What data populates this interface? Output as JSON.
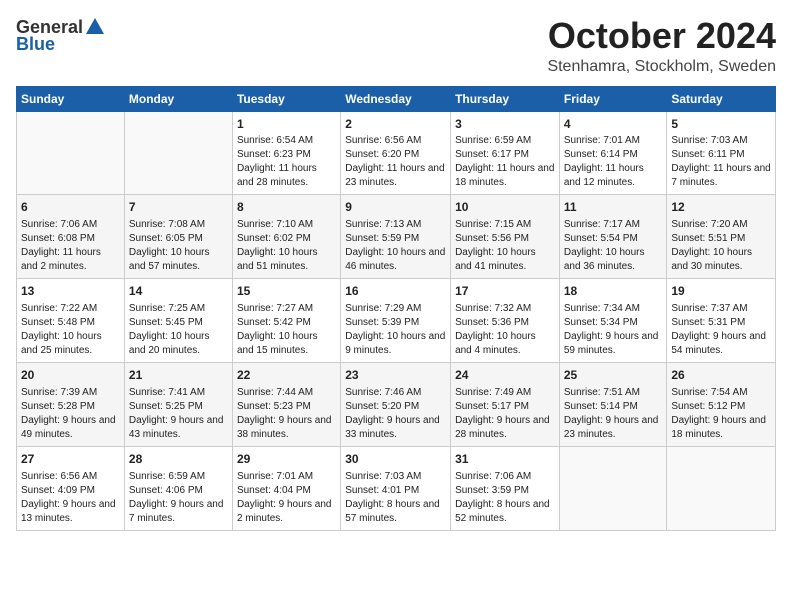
{
  "header": {
    "logo_general": "General",
    "logo_blue": "Blue",
    "month": "October 2024",
    "location": "Stenhamra, Stockholm, Sweden"
  },
  "weekdays": [
    "Sunday",
    "Monday",
    "Tuesday",
    "Wednesday",
    "Thursday",
    "Friday",
    "Saturday"
  ],
  "weeks": [
    [
      {
        "day": "",
        "sunrise": "",
        "sunset": "",
        "daylight": ""
      },
      {
        "day": "",
        "sunrise": "",
        "sunset": "",
        "daylight": ""
      },
      {
        "day": "1",
        "sunrise": "Sunrise: 6:54 AM",
        "sunset": "Sunset: 6:23 PM",
        "daylight": "Daylight: 11 hours and 28 minutes."
      },
      {
        "day": "2",
        "sunrise": "Sunrise: 6:56 AM",
        "sunset": "Sunset: 6:20 PM",
        "daylight": "Daylight: 11 hours and 23 minutes."
      },
      {
        "day": "3",
        "sunrise": "Sunrise: 6:59 AM",
        "sunset": "Sunset: 6:17 PM",
        "daylight": "Daylight: 11 hours and 18 minutes."
      },
      {
        "day": "4",
        "sunrise": "Sunrise: 7:01 AM",
        "sunset": "Sunset: 6:14 PM",
        "daylight": "Daylight: 11 hours and 12 minutes."
      },
      {
        "day": "5",
        "sunrise": "Sunrise: 7:03 AM",
        "sunset": "Sunset: 6:11 PM",
        "daylight": "Daylight: 11 hours and 7 minutes."
      }
    ],
    [
      {
        "day": "6",
        "sunrise": "Sunrise: 7:06 AM",
        "sunset": "Sunset: 6:08 PM",
        "daylight": "Daylight: 11 hours and 2 minutes."
      },
      {
        "day": "7",
        "sunrise": "Sunrise: 7:08 AM",
        "sunset": "Sunset: 6:05 PM",
        "daylight": "Daylight: 10 hours and 57 minutes."
      },
      {
        "day": "8",
        "sunrise": "Sunrise: 7:10 AM",
        "sunset": "Sunset: 6:02 PM",
        "daylight": "Daylight: 10 hours and 51 minutes."
      },
      {
        "day": "9",
        "sunrise": "Sunrise: 7:13 AM",
        "sunset": "Sunset: 5:59 PM",
        "daylight": "Daylight: 10 hours and 46 minutes."
      },
      {
        "day": "10",
        "sunrise": "Sunrise: 7:15 AM",
        "sunset": "Sunset: 5:56 PM",
        "daylight": "Daylight: 10 hours and 41 minutes."
      },
      {
        "day": "11",
        "sunrise": "Sunrise: 7:17 AM",
        "sunset": "Sunset: 5:54 PM",
        "daylight": "Daylight: 10 hours and 36 minutes."
      },
      {
        "day": "12",
        "sunrise": "Sunrise: 7:20 AM",
        "sunset": "Sunset: 5:51 PM",
        "daylight": "Daylight: 10 hours and 30 minutes."
      }
    ],
    [
      {
        "day": "13",
        "sunrise": "Sunrise: 7:22 AM",
        "sunset": "Sunset: 5:48 PM",
        "daylight": "Daylight: 10 hours and 25 minutes."
      },
      {
        "day": "14",
        "sunrise": "Sunrise: 7:25 AM",
        "sunset": "Sunset: 5:45 PM",
        "daylight": "Daylight: 10 hours and 20 minutes."
      },
      {
        "day": "15",
        "sunrise": "Sunrise: 7:27 AM",
        "sunset": "Sunset: 5:42 PM",
        "daylight": "Daylight: 10 hours and 15 minutes."
      },
      {
        "day": "16",
        "sunrise": "Sunrise: 7:29 AM",
        "sunset": "Sunset: 5:39 PM",
        "daylight": "Daylight: 10 hours and 9 minutes."
      },
      {
        "day": "17",
        "sunrise": "Sunrise: 7:32 AM",
        "sunset": "Sunset: 5:36 PM",
        "daylight": "Daylight: 10 hours and 4 minutes."
      },
      {
        "day": "18",
        "sunrise": "Sunrise: 7:34 AM",
        "sunset": "Sunset: 5:34 PM",
        "daylight": "Daylight: 9 hours and 59 minutes."
      },
      {
        "day": "19",
        "sunrise": "Sunrise: 7:37 AM",
        "sunset": "Sunset: 5:31 PM",
        "daylight": "Daylight: 9 hours and 54 minutes."
      }
    ],
    [
      {
        "day": "20",
        "sunrise": "Sunrise: 7:39 AM",
        "sunset": "Sunset: 5:28 PM",
        "daylight": "Daylight: 9 hours and 49 minutes."
      },
      {
        "day": "21",
        "sunrise": "Sunrise: 7:41 AM",
        "sunset": "Sunset: 5:25 PM",
        "daylight": "Daylight: 9 hours and 43 minutes."
      },
      {
        "day": "22",
        "sunrise": "Sunrise: 7:44 AM",
        "sunset": "Sunset: 5:23 PM",
        "daylight": "Daylight: 9 hours and 38 minutes."
      },
      {
        "day": "23",
        "sunrise": "Sunrise: 7:46 AM",
        "sunset": "Sunset: 5:20 PM",
        "daylight": "Daylight: 9 hours and 33 minutes."
      },
      {
        "day": "24",
        "sunrise": "Sunrise: 7:49 AM",
        "sunset": "Sunset: 5:17 PM",
        "daylight": "Daylight: 9 hours and 28 minutes."
      },
      {
        "day": "25",
        "sunrise": "Sunrise: 7:51 AM",
        "sunset": "Sunset: 5:14 PM",
        "daylight": "Daylight: 9 hours and 23 minutes."
      },
      {
        "day": "26",
        "sunrise": "Sunrise: 7:54 AM",
        "sunset": "Sunset: 5:12 PM",
        "daylight": "Daylight: 9 hours and 18 minutes."
      }
    ],
    [
      {
        "day": "27",
        "sunrise": "Sunrise: 6:56 AM",
        "sunset": "Sunset: 4:09 PM",
        "daylight": "Daylight: 9 hours and 13 minutes."
      },
      {
        "day": "28",
        "sunrise": "Sunrise: 6:59 AM",
        "sunset": "Sunset: 4:06 PM",
        "daylight": "Daylight: 9 hours and 7 minutes."
      },
      {
        "day": "29",
        "sunrise": "Sunrise: 7:01 AM",
        "sunset": "Sunset: 4:04 PM",
        "daylight": "Daylight: 9 hours and 2 minutes."
      },
      {
        "day": "30",
        "sunrise": "Sunrise: 7:03 AM",
        "sunset": "Sunset: 4:01 PM",
        "daylight": "Daylight: 8 hours and 57 minutes."
      },
      {
        "day": "31",
        "sunrise": "Sunrise: 7:06 AM",
        "sunset": "Sunset: 3:59 PM",
        "daylight": "Daylight: 8 hours and 52 minutes."
      },
      {
        "day": "",
        "sunrise": "",
        "sunset": "",
        "daylight": ""
      },
      {
        "day": "",
        "sunrise": "",
        "sunset": "",
        "daylight": ""
      }
    ]
  ]
}
